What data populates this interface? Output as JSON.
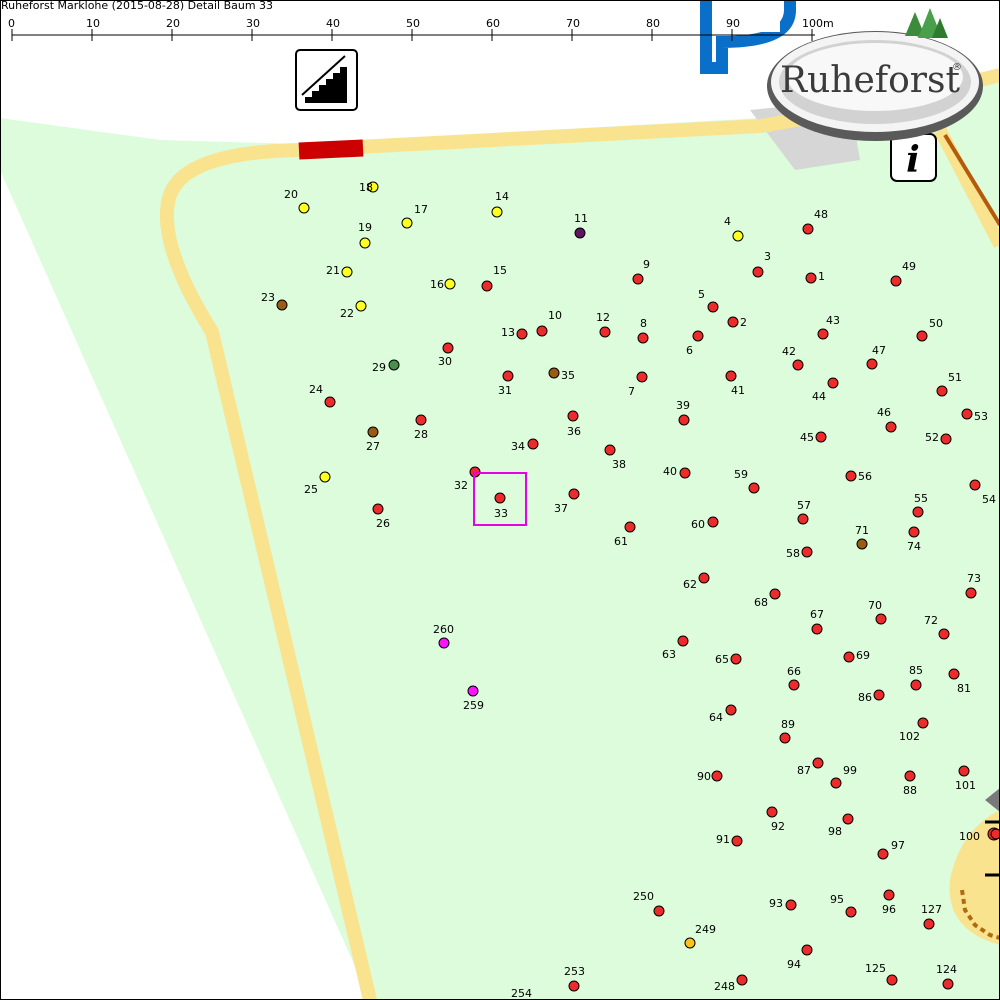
{
  "title": "Ruheforst Marklohe (2015-08-28) Detail  Baum 33",
  "scale": {
    "ticks": [
      "0",
      "10",
      "20",
      "30",
      "40",
      "50",
      "60",
      "70",
      "80",
      "90",
      "100m"
    ]
  },
  "logo": {
    "text": "Ruheforst",
    "mark": "®"
  },
  "icons": [
    "stairs-sign-icon",
    "info-sign-icon",
    "parking-p-icon",
    "forest-trees-icon"
  ],
  "info_sign": "i",
  "colors": {
    "forest": "#dcfcdc",
    "path": "#f9e38e",
    "red": "#ee2b2b",
    "yellow": "#ffff20",
    "brown": "#9a5b12",
    "green": "#4a8f4a",
    "purple": "#5e1660",
    "magenta": "#ff13ff",
    "orange": "#ffc21a",
    "highlight": "#e800e8",
    "barrier": "#cc0000",
    "parking": "#0a6fc8"
  },
  "highlighted_tree": "33",
  "trees": [
    {
      "label": "18",
      "color": "yellow"
    },
    {
      "label": "20",
      "color": "yellow"
    },
    {
      "label": "17",
      "color": "yellow"
    },
    {
      "label": "14",
      "color": "yellow"
    },
    {
      "label": "11",
      "color": "purple"
    },
    {
      "label": "4",
      "color": "yellow"
    },
    {
      "label": "48",
      "color": "red"
    },
    {
      "label": "19",
      "color": "yellow"
    },
    {
      "label": "3",
      "color": "red"
    },
    {
      "label": "9",
      "color": "red"
    },
    {
      "label": "1",
      "color": "red"
    },
    {
      "label": "49",
      "color": "red"
    },
    {
      "label": "21",
      "color": "yellow"
    },
    {
      "label": "15",
      "color": "red"
    },
    {
      "label": "16",
      "color": "yellow"
    },
    {
      "label": "23",
      "color": "brown"
    },
    {
      "label": "22",
      "color": "yellow"
    },
    {
      "label": "5",
      "color": "red"
    },
    {
      "label": "2",
      "color": "red"
    },
    {
      "label": "10",
      "color": "red"
    },
    {
      "label": "13",
      "color": "red"
    },
    {
      "label": "12",
      "color": "red"
    },
    {
      "label": "8",
      "color": "red"
    },
    {
      "label": "6",
      "color": "red"
    },
    {
      "label": "43",
      "color": "red"
    },
    {
      "label": "50",
      "color": "red"
    },
    {
      "label": "30",
      "color": "red"
    },
    {
      "label": "29",
      "color": "green"
    },
    {
      "label": "42",
      "color": "red"
    },
    {
      "label": "47",
      "color": "red"
    },
    {
      "label": "31",
      "color": "red"
    },
    {
      "label": "35",
      "color": "brown"
    },
    {
      "label": "7",
      "color": "red"
    },
    {
      "label": "41",
      "color": "red"
    },
    {
      "label": "44",
      "color": "red"
    },
    {
      "label": "51",
      "color": "red"
    },
    {
      "label": "24",
      "color": "red"
    },
    {
      "label": "28",
      "color": "red"
    },
    {
      "label": "36",
      "color": "red"
    },
    {
      "label": "39",
      "color": "red"
    },
    {
      "label": "46",
      "color": "red"
    },
    {
      "label": "53",
      "color": "red"
    },
    {
      "label": "27",
      "color": "brown"
    },
    {
      "label": "34",
      "color": "red"
    },
    {
      "label": "38",
      "color": "red"
    },
    {
      "label": "45",
      "color": "red"
    },
    {
      "label": "52",
      "color": "red"
    },
    {
      "label": "32",
      "color": "red"
    },
    {
      "label": "40",
      "color": "red"
    },
    {
      "label": "59",
      "color": "red"
    },
    {
      "label": "56",
      "color": "red"
    },
    {
      "label": "25",
      "color": "yellow"
    },
    {
      "label": "54",
      "color": "red"
    },
    {
      "label": "33",
      "color": "red"
    },
    {
      "label": "37",
      "color": "red"
    },
    {
      "label": "55",
      "color": "red"
    },
    {
      "label": "26",
      "color": "red"
    },
    {
      "label": "57",
      "color": "red"
    },
    {
      "label": "60",
      "color": "red"
    },
    {
      "label": "61",
      "color": "red"
    },
    {
      "label": "71",
      "color": "brown"
    },
    {
      "label": "74",
      "color": "red"
    },
    {
      "label": "58",
      "color": "red"
    },
    {
      "label": "62",
      "color": "red"
    },
    {
      "label": "73",
      "color": "red"
    },
    {
      "label": "68",
      "color": "red"
    },
    {
      "label": "67",
      "color": "red"
    },
    {
      "label": "70",
      "color": "red"
    },
    {
      "label": "72",
      "color": "red"
    },
    {
      "label": "260",
      "color": "magenta"
    },
    {
      "label": "63",
      "color": "red"
    },
    {
      "label": "69",
      "color": "red"
    },
    {
      "label": "65",
      "color": "red"
    },
    {
      "label": "85",
      "color": "red"
    },
    {
      "label": "81",
      "color": "red"
    },
    {
      "label": "66",
      "color": "red"
    },
    {
      "label": "86",
      "color": "red"
    },
    {
      "label": "259",
      "color": "magenta"
    },
    {
      "label": "64",
      "color": "red"
    },
    {
      "label": "89",
      "color": "red"
    },
    {
      "label": "102",
      "color": "red"
    },
    {
      "label": "87",
      "color": "red"
    },
    {
      "label": "99",
      "color": "red"
    },
    {
      "label": "90",
      "color": "red"
    },
    {
      "label": "88",
      "color": "red"
    },
    {
      "label": "101",
      "color": "red"
    },
    {
      "label": "92",
      "color": "red"
    },
    {
      "label": "98",
      "color": "red"
    },
    {
      "label": "91",
      "color": "red"
    },
    {
      "label": "97",
      "color": "red"
    },
    {
      "label": "100",
      "color": "red"
    },
    {
      "label": "250",
      "color": "red"
    },
    {
      "label": "93",
      "color": "red"
    },
    {
      "label": "95",
      "color": "red"
    },
    {
      "label": "96",
      "color": "red"
    },
    {
      "label": "127",
      "color": "red"
    },
    {
      "label": "249",
      "color": "orange"
    },
    {
      "label": "94",
      "color": "red"
    },
    {
      "label": "253",
      "color": "red"
    },
    {
      "label": "248",
      "color": "red"
    },
    {
      "label": "125",
      "color": "red"
    },
    {
      "label": "124",
      "color": "red"
    },
    {
      "label": "254",
      "color": "red"
    }
  ]
}
